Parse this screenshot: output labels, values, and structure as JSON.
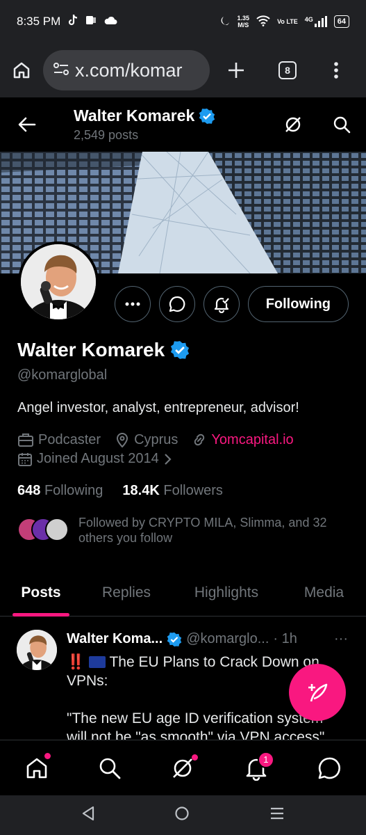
{
  "status_bar": {
    "time": "8:35 PM",
    "net_speed_value": "1.35",
    "net_speed_unit": "M/S",
    "volte": "Vo LTE",
    "network": "4G",
    "battery": "64"
  },
  "browser": {
    "url": "x.com/komar",
    "tab_count": "8"
  },
  "header": {
    "name": "Walter Komarek",
    "posts_count": "2,549 posts"
  },
  "profile": {
    "name": "Walter Komarek",
    "handle": "@komarglobal",
    "bio": "Angel investor, analyst, entrepreneur, advisor!",
    "category": "Podcaster",
    "location": "Cyprus",
    "website": "Yomcapital.io",
    "joined": "Joined August 2014",
    "following_count": "648",
    "following_label": "Following",
    "followers_count": "18.4K",
    "followers_label": "Followers",
    "followed_by": "Followed by CRYPTO MILA, Slimma, and 32 others you follow",
    "follow_button": "Following"
  },
  "tabs": [
    {
      "label": "Posts",
      "active": true
    },
    {
      "label": "Replies",
      "active": false
    },
    {
      "label": "Highlights",
      "active": false
    },
    {
      "label": "Media",
      "active": false
    }
  ],
  "tweet": {
    "author": "Walter Koma...",
    "handle": "@komarglo...",
    "time": "· 1h",
    "more": "···",
    "line1_marks": "‼️",
    "line1_text": "The EU Plans to Crack Down on",
    "line2": "VPNs:",
    "line3": "\"The new EU age ID verification system",
    "line4": "will not be \"as smooth\" via VPN access\""
  },
  "bottom_nav": {
    "notifications_badge": "1"
  },
  "colors": {
    "accent": "#f91880",
    "verified": "#1d9bf0",
    "muted": "#71767b",
    "chrome_bg": "#202124"
  }
}
